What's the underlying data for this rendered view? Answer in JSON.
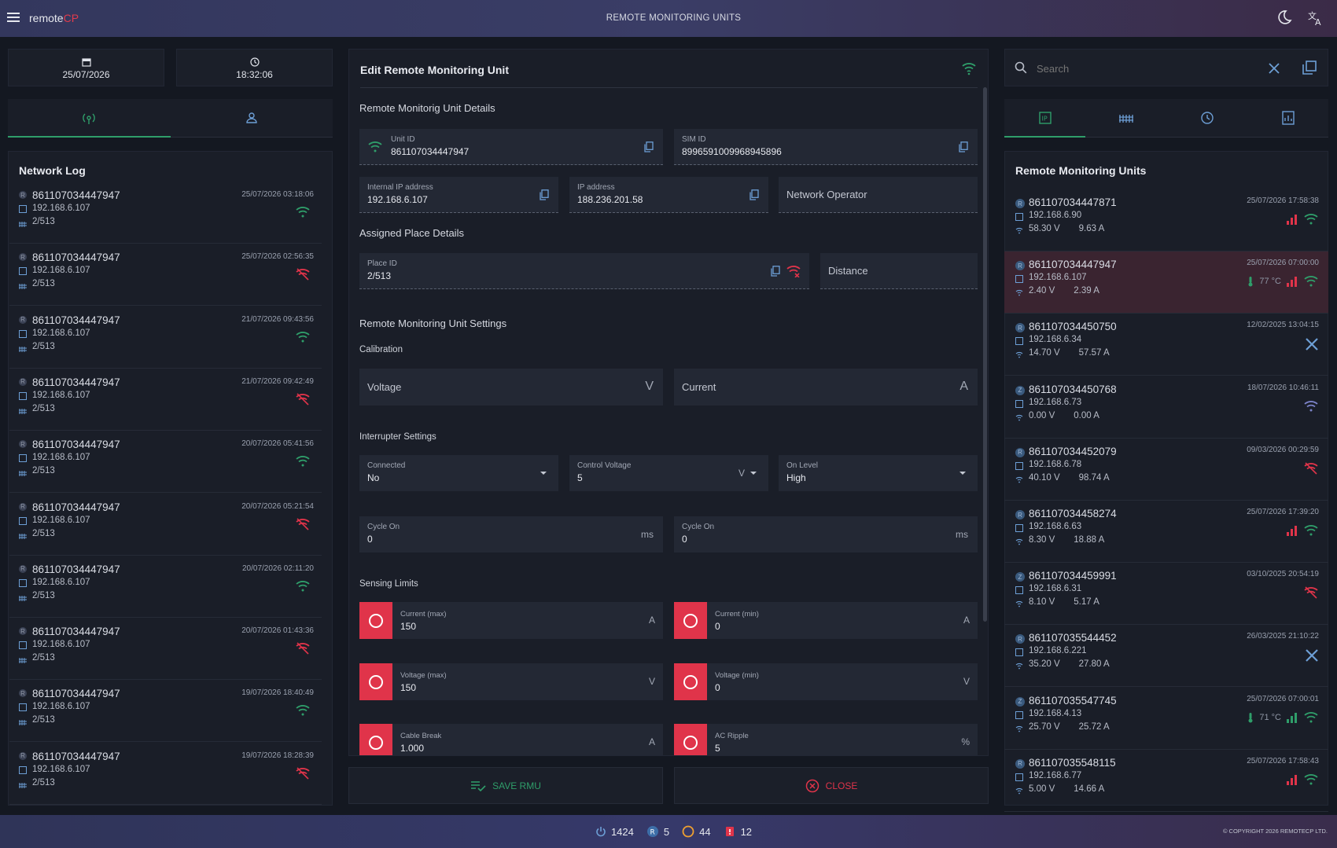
{
  "app": {
    "brand_main": "remote",
    "brand_accent": "CP",
    "title": "REMOTE MONITORING UNITS"
  },
  "datetime": {
    "date": "25/07/2026",
    "time": "18:32:06"
  },
  "network_log": {
    "title": "Network Log",
    "items": [
      {
        "uid": "861107034447947",
        "ts": "25/07/2026 03:18:06",
        "ip": "192.168.6.107",
        "place": "2/513",
        "online": true
      },
      {
        "uid": "861107034447947",
        "ts": "25/07/2026 02:56:35",
        "ip": "192.168.6.107",
        "place": "2/513",
        "online": false
      },
      {
        "uid": "861107034447947",
        "ts": "21/07/2026 09:43:56",
        "ip": "192.168.6.107",
        "place": "2/513",
        "online": true
      },
      {
        "uid": "861107034447947",
        "ts": "21/07/2026 09:42:49",
        "ip": "192.168.6.107",
        "place": "2/513",
        "online": false
      },
      {
        "uid": "861107034447947",
        "ts": "20/07/2026 05:41:56",
        "ip": "192.168.6.107",
        "place": "2/513",
        "online": true
      },
      {
        "uid": "861107034447947",
        "ts": "20/07/2026 05:21:54",
        "ip": "192.168.6.107",
        "place": "2/513",
        "online": false
      },
      {
        "uid": "861107034447947",
        "ts": "20/07/2026 02:11:20",
        "ip": "192.168.6.107",
        "place": "2/513",
        "online": true
      },
      {
        "uid": "861107034447947",
        "ts": "20/07/2026 01:43:36",
        "ip": "192.168.6.107",
        "place": "2/513",
        "online": false
      },
      {
        "uid": "861107034447947",
        "ts": "19/07/2026 18:40:49",
        "ip": "192.168.6.107",
        "place": "2/513",
        "online": true
      },
      {
        "uid": "861107034447947",
        "ts": "19/07/2026 18:28:39",
        "ip": "192.168.6.107",
        "place": "2/513",
        "online": false
      }
    ]
  },
  "editor": {
    "title": "Edit Remote Monitoring Unit",
    "details_title": "Remote Monitorig Unit Details",
    "unit_id_label": "Unit ID",
    "unit_id": "861107034447947",
    "sim_id_label": "SIM ID",
    "sim_id": "8996591009968945896",
    "internal_ip_label": "Internal IP address",
    "internal_ip": "192.168.6.107",
    "ip_label": "IP address",
    "ip": "188.236.201.58",
    "operator_placeholder": "Network Operator",
    "place_title": "Assigned Place Details",
    "place_id_label": "Place ID",
    "place_id": "2/513",
    "distance_placeholder": "Distance",
    "settings_title": "Remote Monitoring Unit Settings",
    "calibration_title": "Calibration",
    "voltage_placeholder": "Voltage",
    "voltage_unit": "V",
    "current_placeholder": "Current",
    "current_unit": "A",
    "interrupter_title": "Interrupter Settings",
    "connected_label": "Connected",
    "connected_value": "No",
    "control_voltage_label": "Control Voltage",
    "control_voltage_value": "5",
    "control_voltage_unit": "V",
    "on_level_label": "On Level",
    "on_level_value": "High",
    "cycle_on_label_1": "Cycle On",
    "cycle_on_value_1": "0",
    "cycle_on_unit_1": "ms",
    "cycle_on_label_2": "Cycle On",
    "cycle_on_value_2": "0",
    "cycle_on_unit_2": "ms",
    "sensing_title": "Sensing Limits",
    "limits": {
      "current_max": {
        "label": "Current (max)",
        "value": "150",
        "unit": "A"
      },
      "current_min": {
        "label": "Current (min)",
        "value": "0",
        "unit": "A"
      },
      "voltage_max": {
        "label": "Voltage (max)",
        "value": "150",
        "unit": "V"
      },
      "voltage_min": {
        "label": "Voltage (min)",
        "value": "0",
        "unit": "V"
      },
      "cable_break": {
        "label": "Cable Break",
        "value": "1.000",
        "unit": "A"
      },
      "ac_ripple": {
        "label": "AC Ripple",
        "value": "5",
        "unit": "%"
      }
    },
    "save_label": "SAVE RMU",
    "close_label": "CLOSE"
  },
  "search": {
    "placeholder": "Search"
  },
  "rmu_list": {
    "title": "Remote Monitoring Units",
    "items": [
      {
        "badge": "R",
        "uid": "861107034447871",
        "ts": "25/07/2026 17:58:38",
        "ip": "192.168.6.90",
        "voltage": "58.30 V",
        "current": "9.63 A",
        "temp": "",
        "status": "online-weak"
      },
      {
        "badge": "R",
        "uid": "861107034447947",
        "ts": "25/07/2026 07:00:00",
        "ip": "192.168.6.107",
        "voltage": "2.40 V",
        "current": "2.39 A",
        "temp": "77 °C",
        "status": "online-weak"
      },
      {
        "badge": "R",
        "uid": "861107034450750",
        "ts": "12/02/2025 13:04:15",
        "ip": "192.168.6.34",
        "voltage": "14.70 V",
        "current": "57.57 A",
        "temp": "",
        "status": "maintenance"
      },
      {
        "badge": "Z",
        "uid": "861107034450768",
        "ts": "18/07/2026 10:46:11",
        "ip": "192.168.6.73",
        "voltage": "0.00 V",
        "current": "0.00 A",
        "temp": "",
        "status": "wifi-dim"
      },
      {
        "badge": "R",
        "uid": "861107034452079",
        "ts": "09/03/2026 00:29:59",
        "ip": "192.168.6.78",
        "voltage": "40.10 V",
        "current": "98.74 A",
        "temp": "",
        "status": "offline"
      },
      {
        "badge": "R",
        "uid": "861107034458274",
        "ts": "25/07/2026 17:39:20",
        "ip": "192.168.6.63",
        "voltage": "8.30 V",
        "current": "18.88 A",
        "temp": "",
        "status": "online-weak"
      },
      {
        "badge": "Z",
        "uid": "861107034459991",
        "ts": "03/10/2025 20:54:19",
        "ip": "192.168.6.31",
        "voltage": "8.10 V",
        "current": "5.17 A",
        "temp": "",
        "status": "offline"
      },
      {
        "badge": "R",
        "uid": "861107035544452",
        "ts": "26/03/2025 21:10:22",
        "ip": "192.168.6.221",
        "voltage": "35.20 V",
        "current": "27.80 A",
        "temp": "",
        "status": "maintenance"
      },
      {
        "badge": "Z",
        "uid": "861107035547745",
        "ts": "25/07/2026 07:00:01",
        "ip": "192.168.4.13",
        "voltage": "25.70 V",
        "current": "25.72 A",
        "temp": "71 °C",
        "status": "online-strong"
      },
      {
        "badge": "R",
        "uid": "861107035548115",
        "ts": "25/07/2026 17:58:43",
        "ip": "192.168.6.77",
        "voltage": "5.00 V",
        "current": "14.66 A",
        "temp": "",
        "status": "online-weak"
      }
    ]
  },
  "footer": {
    "power": "1424",
    "rmu": "5",
    "circle": "44",
    "alarm": "12",
    "copyright": "© COPYRIGHT 2026 REMOTECP LTD."
  },
  "colors": {
    "green": "#2f9e6a",
    "red": "#e0344a",
    "accent_blue": "#3d6ea8"
  }
}
